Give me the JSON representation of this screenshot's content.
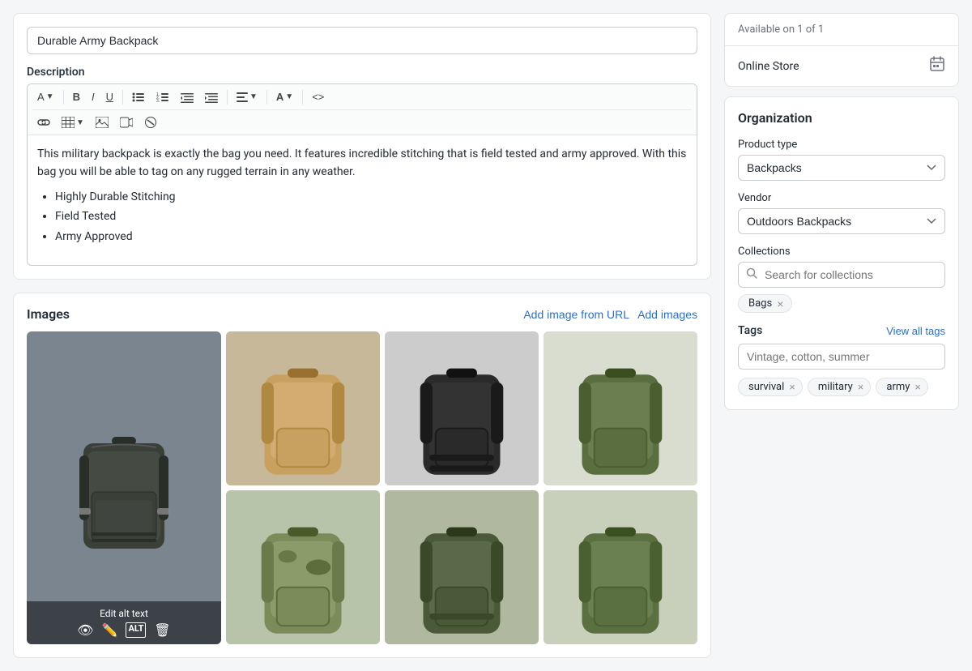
{
  "product": {
    "title": "Durable Army Backpack",
    "description_text": "This military backpack is exactly the bag you need. It features incredible stitching that is field tested and army approved. With this bag you will be able to tag on any rugged terrain in any weather.",
    "description_bullets": [
      "Highly Durable Stitching",
      "Field Tested",
      "Army Approved"
    ]
  },
  "description_label": "Description",
  "images": {
    "section_title": "Images",
    "add_from_url": "Add image from URL",
    "add_images": "Add images",
    "edit_alt_text": "Edit alt text"
  },
  "availability": {
    "header": "Available on 1 of 1",
    "store_name": "Online Store"
  },
  "organization": {
    "title": "Organization",
    "product_type_label": "Product type",
    "product_type_value": "Backpacks",
    "vendor_label": "Vendor",
    "vendor_value": "Outdoors Backpacks",
    "collections_label": "Collections",
    "collections_placeholder": "Search for collections",
    "existing_collection": "Bags",
    "tags_label": "Tags",
    "view_all_tags": "View all tags",
    "tags_placeholder": "Vintage, cotton, summer",
    "tags": [
      "survival",
      "military",
      "army"
    ]
  },
  "toolbar": {
    "font_size": "A",
    "bold": "B",
    "italic": "I",
    "underline": "U",
    "bullet_list": "≡",
    "ordered_list": "≡",
    "indent_left": "⇤",
    "indent_right": "⇥",
    "align": "≡",
    "font_color": "A",
    "link": "🔗",
    "table": "▦",
    "image": "🖼",
    "video": "▶",
    "clear": "⊘",
    "html": "<>"
  }
}
